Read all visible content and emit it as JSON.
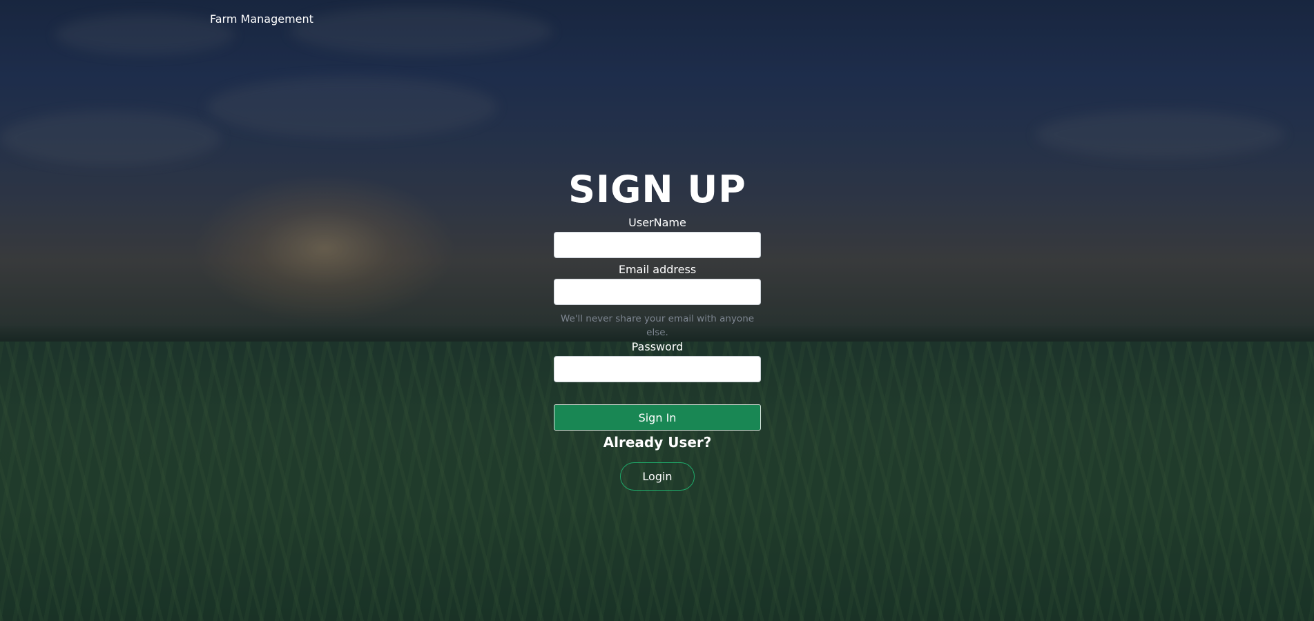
{
  "navbar": {
    "brand": "Farm Management"
  },
  "form": {
    "title": "SIGN UP",
    "username_label": "UserName",
    "username_value": "",
    "email_label": "Email address",
    "email_value": "",
    "email_help": "We'll never share your email with anyone else.",
    "password_label": "Password",
    "password_value": "",
    "submit_label": "Sign In",
    "already_user_text": "Already User?",
    "login_label": "Login"
  },
  "colors": {
    "submit_bg": "#198754",
    "login_border": "#1faa6a",
    "text": "#ffffff",
    "help_text": "#7d8590"
  }
}
